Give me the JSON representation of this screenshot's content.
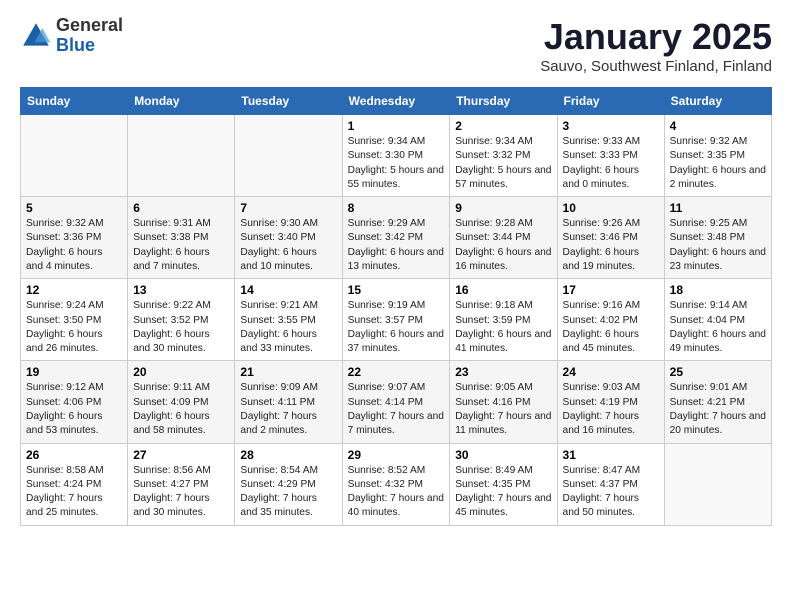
{
  "header": {
    "logo_general": "General",
    "logo_blue": "Blue",
    "title": "January 2025",
    "location": "Sauvo, Southwest Finland, Finland"
  },
  "days_of_week": [
    "Sunday",
    "Monday",
    "Tuesday",
    "Wednesday",
    "Thursday",
    "Friday",
    "Saturday"
  ],
  "weeks": [
    [
      {
        "day": "",
        "info": ""
      },
      {
        "day": "",
        "info": ""
      },
      {
        "day": "",
        "info": ""
      },
      {
        "day": "1",
        "info": "Sunrise: 9:34 AM\nSunset: 3:30 PM\nDaylight: 5 hours and 55 minutes."
      },
      {
        "day": "2",
        "info": "Sunrise: 9:34 AM\nSunset: 3:32 PM\nDaylight: 5 hours and 57 minutes."
      },
      {
        "day": "3",
        "info": "Sunrise: 9:33 AM\nSunset: 3:33 PM\nDaylight: 6 hours and 0 minutes."
      },
      {
        "day": "4",
        "info": "Sunrise: 9:32 AM\nSunset: 3:35 PM\nDaylight: 6 hours and 2 minutes."
      }
    ],
    [
      {
        "day": "5",
        "info": "Sunrise: 9:32 AM\nSunset: 3:36 PM\nDaylight: 6 hours and 4 minutes."
      },
      {
        "day": "6",
        "info": "Sunrise: 9:31 AM\nSunset: 3:38 PM\nDaylight: 6 hours and 7 minutes."
      },
      {
        "day": "7",
        "info": "Sunrise: 9:30 AM\nSunset: 3:40 PM\nDaylight: 6 hours and 10 minutes."
      },
      {
        "day": "8",
        "info": "Sunrise: 9:29 AM\nSunset: 3:42 PM\nDaylight: 6 hours and 13 minutes."
      },
      {
        "day": "9",
        "info": "Sunrise: 9:28 AM\nSunset: 3:44 PM\nDaylight: 6 hours and 16 minutes."
      },
      {
        "day": "10",
        "info": "Sunrise: 9:26 AM\nSunset: 3:46 PM\nDaylight: 6 hours and 19 minutes."
      },
      {
        "day": "11",
        "info": "Sunrise: 9:25 AM\nSunset: 3:48 PM\nDaylight: 6 hours and 23 minutes."
      }
    ],
    [
      {
        "day": "12",
        "info": "Sunrise: 9:24 AM\nSunset: 3:50 PM\nDaylight: 6 hours and 26 minutes."
      },
      {
        "day": "13",
        "info": "Sunrise: 9:22 AM\nSunset: 3:52 PM\nDaylight: 6 hours and 30 minutes."
      },
      {
        "day": "14",
        "info": "Sunrise: 9:21 AM\nSunset: 3:55 PM\nDaylight: 6 hours and 33 minutes."
      },
      {
        "day": "15",
        "info": "Sunrise: 9:19 AM\nSunset: 3:57 PM\nDaylight: 6 hours and 37 minutes."
      },
      {
        "day": "16",
        "info": "Sunrise: 9:18 AM\nSunset: 3:59 PM\nDaylight: 6 hours and 41 minutes."
      },
      {
        "day": "17",
        "info": "Sunrise: 9:16 AM\nSunset: 4:02 PM\nDaylight: 6 hours and 45 minutes."
      },
      {
        "day": "18",
        "info": "Sunrise: 9:14 AM\nSunset: 4:04 PM\nDaylight: 6 hours and 49 minutes."
      }
    ],
    [
      {
        "day": "19",
        "info": "Sunrise: 9:12 AM\nSunset: 4:06 PM\nDaylight: 6 hours and 53 minutes."
      },
      {
        "day": "20",
        "info": "Sunrise: 9:11 AM\nSunset: 4:09 PM\nDaylight: 6 hours and 58 minutes."
      },
      {
        "day": "21",
        "info": "Sunrise: 9:09 AM\nSunset: 4:11 PM\nDaylight: 7 hours and 2 minutes."
      },
      {
        "day": "22",
        "info": "Sunrise: 9:07 AM\nSunset: 4:14 PM\nDaylight: 7 hours and 7 minutes."
      },
      {
        "day": "23",
        "info": "Sunrise: 9:05 AM\nSunset: 4:16 PM\nDaylight: 7 hours and 11 minutes."
      },
      {
        "day": "24",
        "info": "Sunrise: 9:03 AM\nSunset: 4:19 PM\nDaylight: 7 hours and 16 minutes."
      },
      {
        "day": "25",
        "info": "Sunrise: 9:01 AM\nSunset: 4:21 PM\nDaylight: 7 hours and 20 minutes."
      }
    ],
    [
      {
        "day": "26",
        "info": "Sunrise: 8:58 AM\nSunset: 4:24 PM\nDaylight: 7 hours and 25 minutes."
      },
      {
        "day": "27",
        "info": "Sunrise: 8:56 AM\nSunset: 4:27 PM\nDaylight: 7 hours and 30 minutes."
      },
      {
        "day": "28",
        "info": "Sunrise: 8:54 AM\nSunset: 4:29 PM\nDaylight: 7 hours and 35 minutes."
      },
      {
        "day": "29",
        "info": "Sunrise: 8:52 AM\nSunset: 4:32 PM\nDaylight: 7 hours and 40 minutes."
      },
      {
        "day": "30",
        "info": "Sunrise: 8:49 AM\nSunset: 4:35 PM\nDaylight: 7 hours and 45 minutes."
      },
      {
        "day": "31",
        "info": "Sunrise: 8:47 AM\nSunset: 4:37 PM\nDaylight: 7 hours and 50 minutes."
      },
      {
        "day": "",
        "info": ""
      }
    ]
  ]
}
